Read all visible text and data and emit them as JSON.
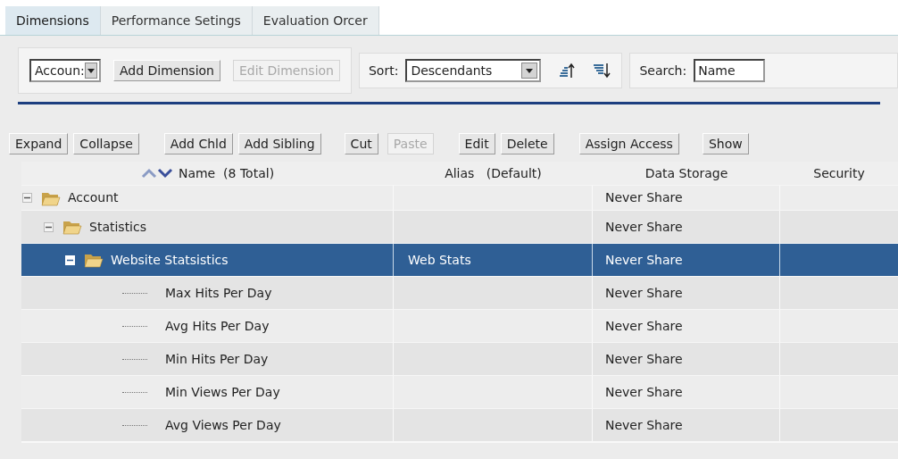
{
  "tabs": [
    {
      "label": "Dimensions",
      "selected": true
    },
    {
      "label": "Performance Setings",
      "selected": false
    },
    {
      "label": "Evaluation Orcer",
      "selected": false
    }
  ],
  "toolbar": {
    "dimension_select": "Accoun:",
    "buttons": [
      {
        "label": "Add Dimension",
        "disabled": false
      },
      {
        "label": "Edit Dimension",
        "disabled": true
      }
    ],
    "sort_label": "Sort:",
    "sort_select": "Descendants",
    "search_label": "Search:",
    "search_value": "Name"
  },
  "actions": [
    {
      "label": "Expand",
      "disabled": false
    },
    {
      "label": "Collapse",
      "disabled": false
    },
    {
      "label": "Add Chld",
      "disabled": false
    },
    {
      "label": "Add Sibling",
      "disabled": false
    },
    {
      "label": "Cut",
      "disabled": false
    },
    {
      "label": "Paste",
      "disabled": true
    },
    {
      "label": "Edit",
      "disabled": false
    },
    {
      "label": "Delete",
      "disabled": false
    },
    {
      "label": "Assign Access",
      "disabled": false
    },
    {
      "label": "Show",
      "disabled": false
    }
  ],
  "table": {
    "columns": [
      "Name  (8 Total)",
      "Alias   (Default)",
      "Data Storage",
      "Security"
    ],
    "rows": [
      {
        "name": "Account",
        "data_storage": "Never Share",
        "expanded": true,
        "selected": false,
        "children": [
          {
            "name": "Statistics",
            "data_storage": "Never Share",
            "expanded": true,
            "selected": false,
            "children": [
              {
                "name": "Website Statsistics",
                "alias": "Web Stats",
                "data_storage": "Never Share",
                "expanded": true,
                "selected": true,
                "children": [
                  {
                    "name": "Max Hits Per Day",
                    "data_storage": "Never Share",
                    "selected": false
                  },
                  {
                    "name": "Avg Hits Per Day",
                    "data_storage": "Never Share",
                    "selected": false
                  },
                  {
                    "name": "Min Hits Per Day",
                    "data_storage": "Never Share",
                    "selected": false
                  },
                  {
                    "name": "Min Views Per Day",
                    "data_storage": "Never Share",
                    "selected": false
                  },
                  {
                    "name": "Avg Views Per Day",
                    "data_storage": "Never Share",
                    "selected": false
                  }
                ]
              }
            ]
          }
        ]
      }
    ]
  }
}
